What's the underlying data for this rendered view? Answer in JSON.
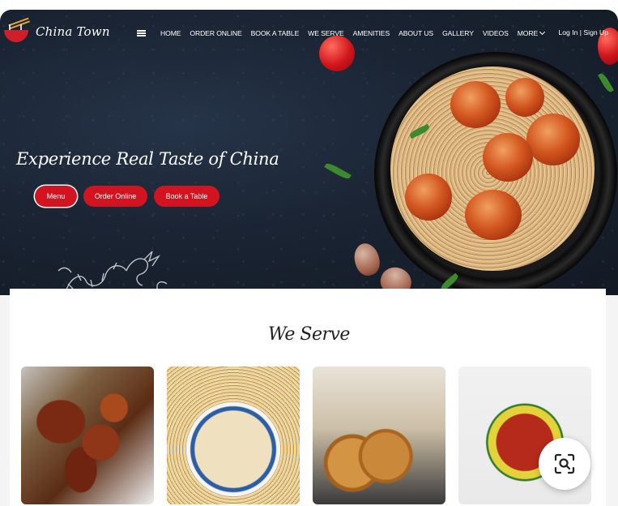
{
  "brand": {
    "name": "China Town"
  },
  "nav": {
    "items": [
      "HOME",
      "ORDER ONLINE",
      "BOOK A TABLE",
      "WE SERVE",
      "AMENITIES",
      "ABOUT US",
      "GALLERY",
      "VIDEOS"
    ],
    "more_label": "MORE",
    "login_label": "Log In",
    "separator": " | ",
    "signup_label": "Sign Up"
  },
  "hero": {
    "headline": "Experience Real Taste of China",
    "buttons": {
      "menu": "Menu",
      "order": "Order Online",
      "book": "Book a Table"
    }
  },
  "serve": {
    "title": "We Serve"
  },
  "colors": {
    "accent": "#d1141f",
    "hero_bg": "#1a2433"
  },
  "icons": [
    "menu-icon",
    "chevron-down-icon",
    "visual-search-icon"
  ]
}
